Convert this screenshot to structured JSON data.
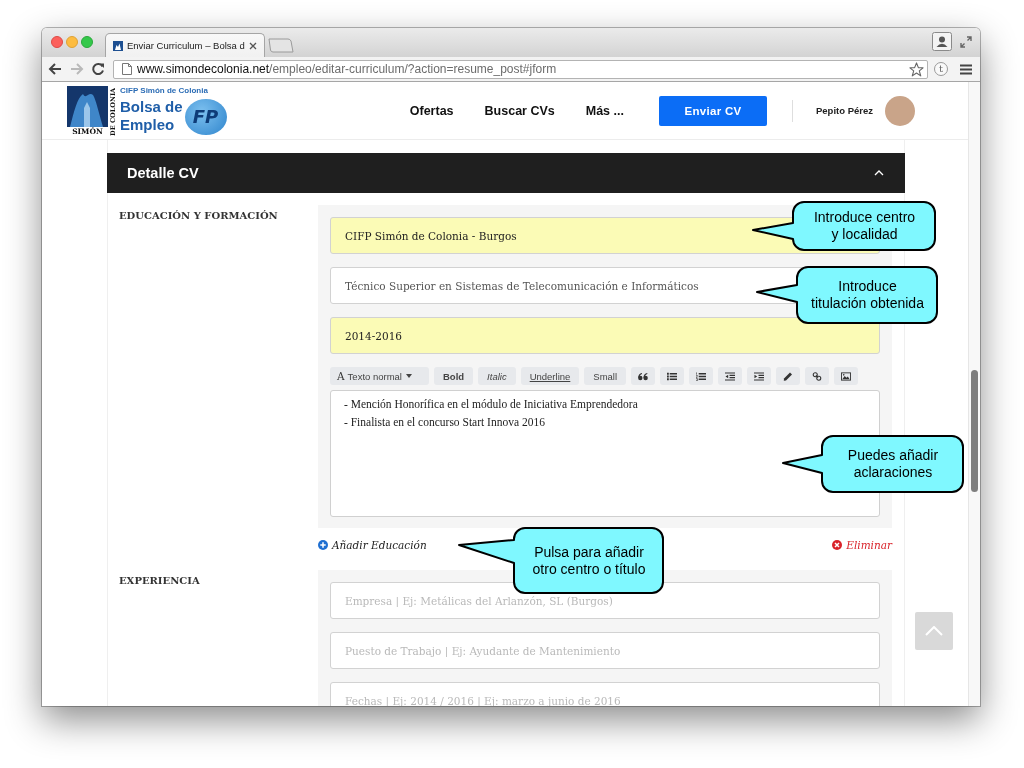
{
  "browser": {
    "tab_title": "Enviar Curriculum – Bolsa d",
    "url_host": "www.simondecolonia.net",
    "url_path": "/empleo/editar-curriculum/?action=resume_post#jform",
    "forward_disabled": true,
    "extension_label": "t"
  },
  "header": {
    "logo": {
      "emblem_text": "SIMÓN",
      "vertical_text": "DE COLONIA",
      "school": "CIFP Simón de Colonia",
      "title_lines": [
        "Bolsa de",
        "Empleo"
      ],
      "badge": "FP"
    },
    "nav": [
      "Ofertas",
      "Buscar CVs",
      "Más ..."
    ],
    "cta": "Enviar CV",
    "user_name": "Pepito Pérez"
  },
  "section": {
    "title": "Detalle CV",
    "expanded": true
  },
  "education": {
    "label": "EDUCACIÓN Y FORMACIÓN",
    "fields": [
      {
        "value": "CIFP Simón de Colonia - Burgos",
        "autofilled": true
      },
      {
        "value": "Técnico Superior en Sistemas de Telecomunicación e Informáticos",
        "autofilled": false
      },
      {
        "value": "2014-2016",
        "autofilled": true
      }
    ],
    "toolbar": [
      {
        "kind": "dropdown",
        "glyph": "A",
        "label": "Texto normal"
      },
      {
        "kind": "bold",
        "label": "Bold"
      },
      {
        "kind": "italic",
        "label": "Italic"
      },
      {
        "kind": "underline",
        "label": "Underline"
      },
      {
        "kind": "small",
        "label": "Small"
      }
    ],
    "description_lines": [
      "- Mención Honorífica en el módulo de Iniciativa Emprendedora",
      "- Finalista en el concurso Start Innova 2016"
    ],
    "add_label": "Añadir Educación",
    "remove_label": "Eliminar"
  },
  "experience": {
    "label": "EXPERIENCIA",
    "fields": [
      {
        "placeholder": "Empresa | Ej: Metálicas del Arlanzón, SL (Burgos)"
      },
      {
        "placeholder": "Puesto de Trabajo | Ej: Ayudante de Mantenimiento"
      },
      {
        "placeholder": "Fechas | Ej: 2014 / 2016 | Ej: marzo a junio de 2016"
      }
    ]
  },
  "callouts": [
    {
      "text": "Introduce centro\ny localidad"
    },
    {
      "text": "Introduce\ntitulación obtenida"
    },
    {
      "text": "Puedes añadir\naclaraciones"
    },
    {
      "text": "Pulsa para añadir\notro centro o título"
    }
  ]
}
